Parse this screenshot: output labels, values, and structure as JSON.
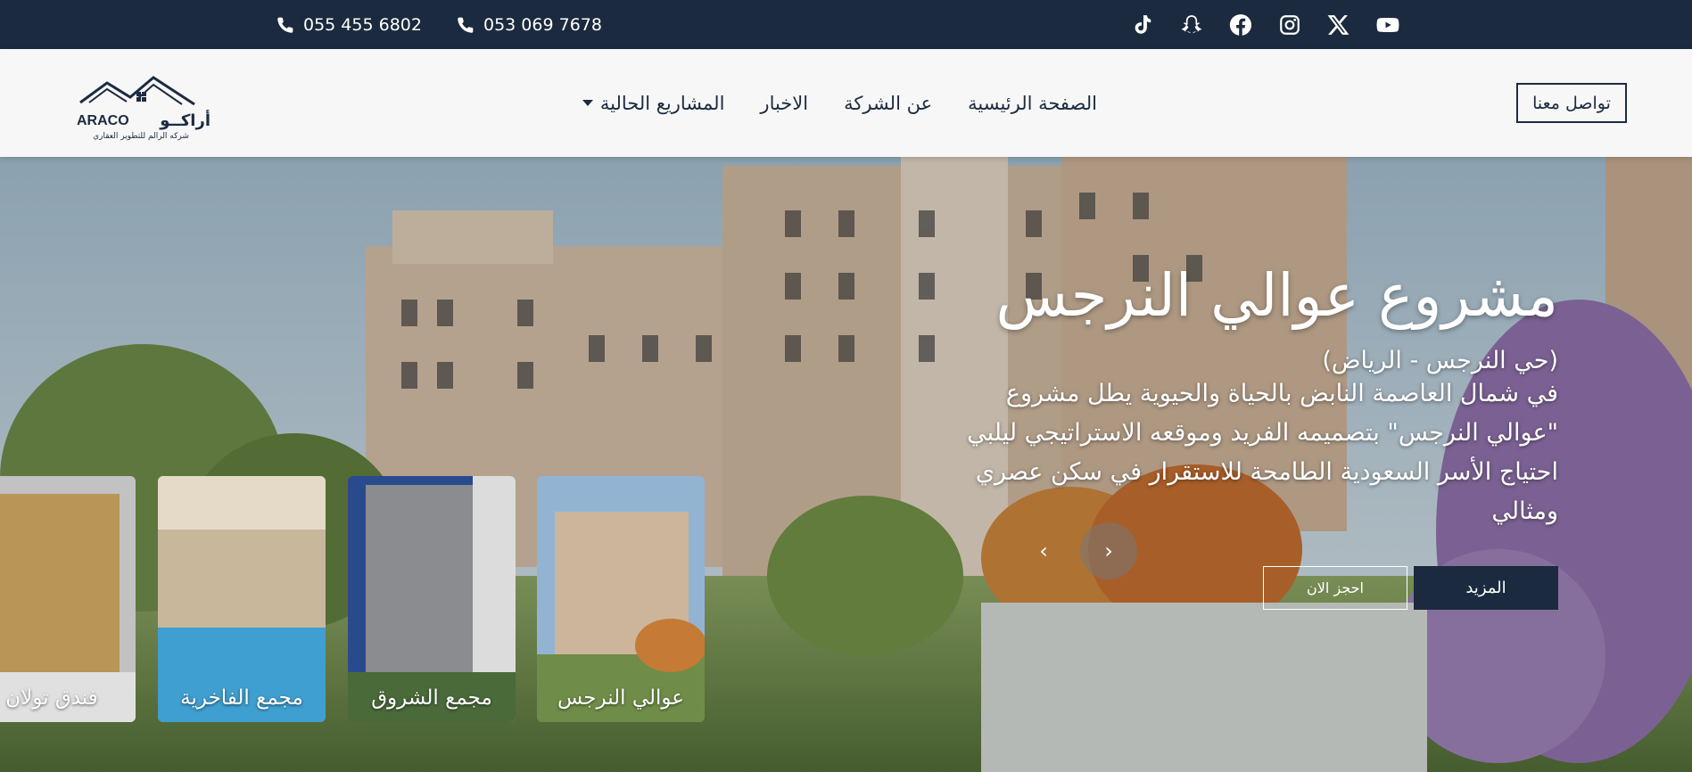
{
  "topbar": {
    "phone1": "055 455 6802",
    "phone2": "053 069 7678",
    "icons": {
      "phone": "phone-icon"
    },
    "socials": [
      "tiktok-icon",
      "snapchat-icon",
      "facebook-icon",
      "instagram-icon",
      "x-icon",
      "youtube-icon"
    ]
  },
  "navbar": {
    "logo_latin": "ARACO",
    "logo_arabic": "أراكــو",
    "logo_tagline": "شركه الرالم للتطوير العقاري",
    "items": [
      "الصفحة الرئيسية",
      "عن الشركة",
      "الاخبار",
      "المشاريع الحالية"
    ],
    "contact_label": "تواصل معنا"
  },
  "hero": {
    "title": "مشروع عوالي النرجس",
    "location": "(حي النرجس - الرياض)",
    "description": "في شمال العاصمة النابض بالحياة والحيوية يطل مشروع \"عوالي النرجس\" بتصميمه الفريد وموقعه الاستراتيجي ليلبي احتياج الأسر السعودية الطامحة للاستقرار في سكن عصري ومثالي",
    "more_label": "المزيد",
    "book_label": "احجز الان",
    "prev_arrow": "‹",
    "next_arrow": "›"
  },
  "thumbs": [
    "عوالي النرجس",
    "مجمع الشروق",
    "مجمع الفاخرية",
    "فندق تولان"
  ],
  "colors": {
    "navy": "#1b2a3e",
    "white": "#ffffff"
  }
}
